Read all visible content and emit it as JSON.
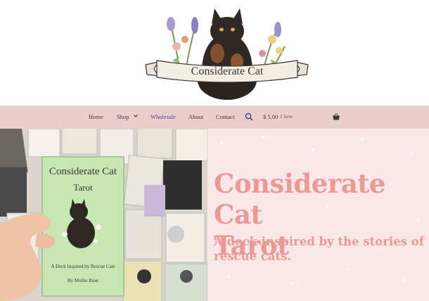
{
  "brand": {
    "logo_text": "Considerate Cat"
  },
  "nav": {
    "items": [
      {
        "label": "Home"
      },
      {
        "label": "Shop"
      },
      {
        "label": "Wholesale"
      },
      {
        "label": "About"
      },
      {
        "label": "Contact"
      }
    ],
    "search_icon": "search-icon",
    "cart_price": "$ 5.00",
    "cart_count": "1 item",
    "cart_icon": "basket-icon"
  },
  "hero": {
    "title": "Considerate Cat\nTarot",
    "subtitle": "A deck inspired by the stories of rescue cats.",
    "card": {
      "title": "Considerate Cat",
      "subtitle": "Tarot",
      "tagline": "A Deck Inspired by Rescue Cats",
      "author": "By Mollie Rose"
    }
  },
  "colors": {
    "nav_bg": "#ebcdcd",
    "hero_bg": "#fbe7e7",
    "accent": "#ea9a95"
  }
}
